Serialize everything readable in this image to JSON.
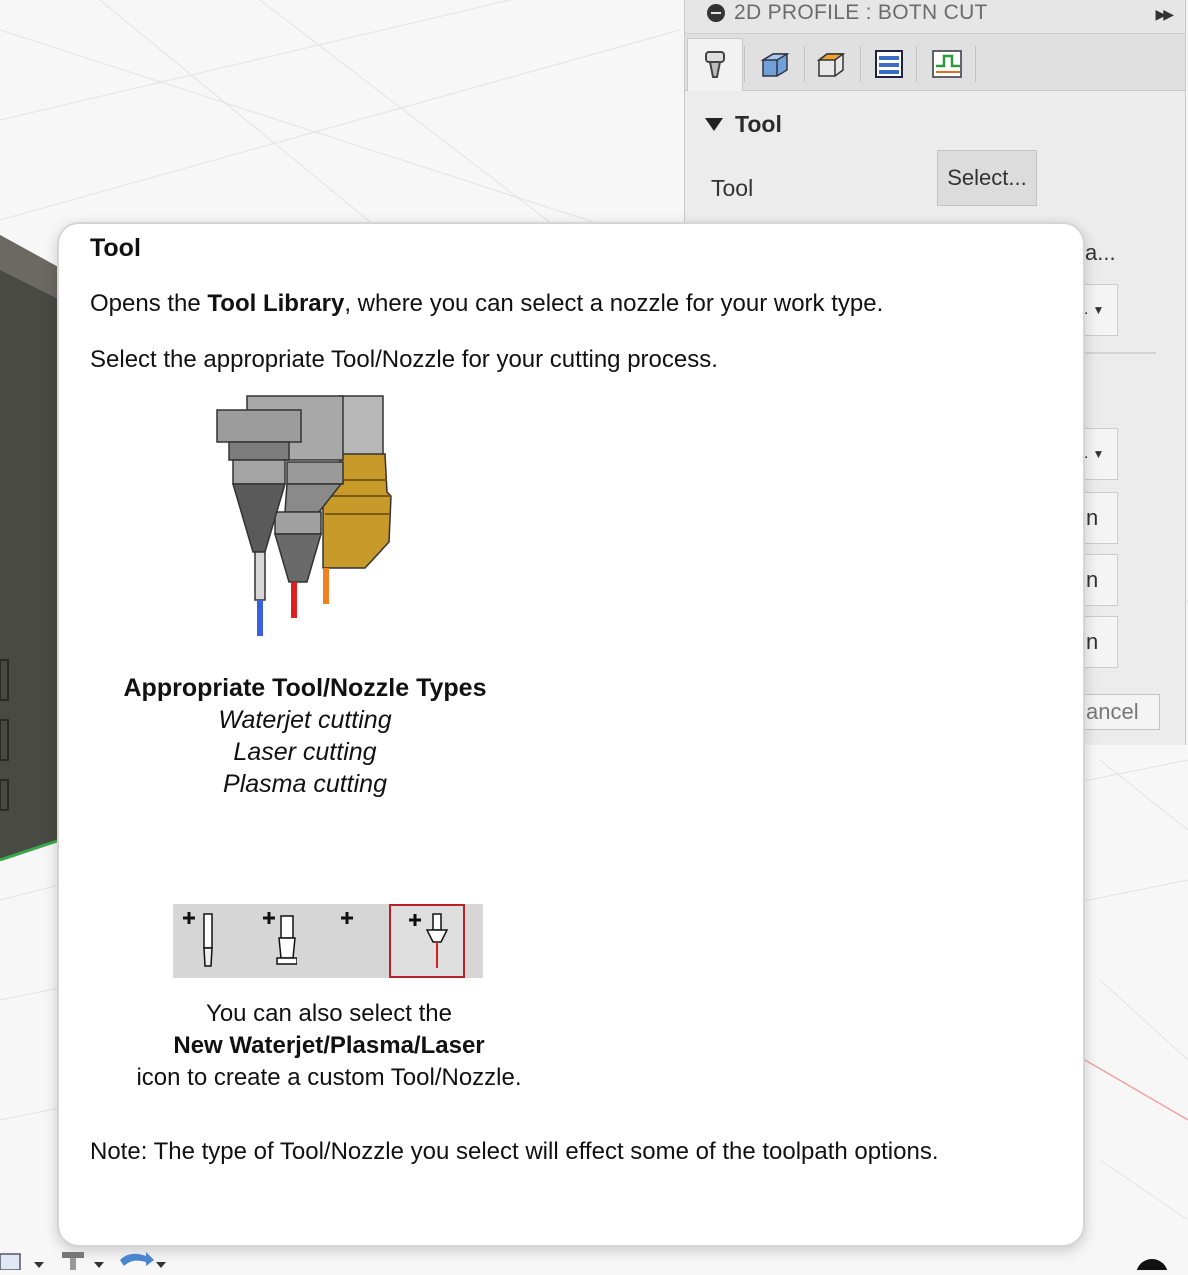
{
  "panel": {
    "title": "2D PROFILE : BOTN CUT",
    "tabs": [
      "tool-icon",
      "geometry-icon",
      "heights-icon",
      "passes-icon",
      "linking-icon"
    ],
    "section_title": "Tool",
    "tool_label": "Tool",
    "select_button": "Select...",
    "partial_texts": [
      "a...",
      ".",
      ".",
      "n",
      "n",
      "n",
      "ancel"
    ]
  },
  "tooltip": {
    "title": "Tool",
    "line1_before": "Opens the ",
    "line1_bold": "Tool Library",
    "line1_after": ", where you can select a nozzle for your work type.",
    "line2": "Select the appropriate Tool/Nozzle for your cutting process.",
    "types_heading": "Appropriate Tool/Nozzle Types",
    "types": [
      "Waterjet cutting",
      "Laser cutting",
      "Plasma cutting"
    ],
    "also_line1": "You can also select the",
    "also_bold": "New Waterjet/Plasma/Laser",
    "also_line3": "icon to create a custom Tool/Nozzle.",
    "note": "Note: The type of Tool/Nozzle you select will effect some of the toolpath options.",
    "new_tool_icons": [
      "new-mill-tool-icon",
      "new-turning-tool-icon",
      "new-probe-tool-icon",
      "new-waterjet-plasma-laser-icon"
    ],
    "nozzle_colors": {
      "waterjet": "#3a5fe0",
      "plasma": "#e02020",
      "laser": "#f08020",
      "brass": "#c89a2a"
    }
  }
}
